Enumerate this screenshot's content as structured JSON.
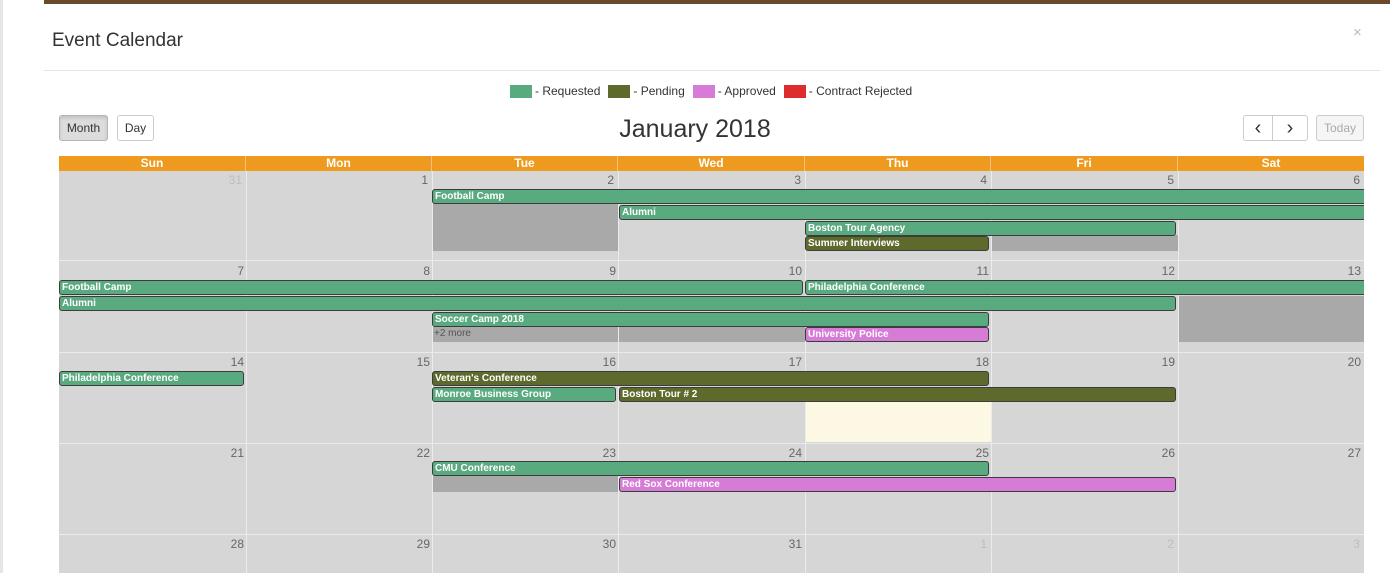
{
  "modal": {
    "title": "Event Calendar",
    "close_glyph": "×"
  },
  "legend": [
    {
      "label": "- Requested",
      "color": "#5aaa80"
    },
    {
      "label": "- Pending",
      "color": "#5d6a2c"
    },
    {
      "label": "- Approved",
      "color": "#d67bd6"
    },
    {
      "label": "- Contract Rejected",
      "color": "#dd2c2c"
    }
  ],
  "toolbar": {
    "month_label": "Month",
    "day_label": "Day",
    "title": "January 2018",
    "prev_glyph": "‹",
    "next_glyph": "›",
    "today_label": "Today"
  },
  "calendar": {
    "day_names": [
      "Sun",
      "Mon",
      "Tue",
      "Wed",
      "Thu",
      "Fri",
      "Sat"
    ],
    "weeks": [
      [
        "31",
        "1",
        "2",
        "3",
        "4",
        "5",
        "6"
      ],
      [
        "7",
        "8",
        "9",
        "10",
        "11",
        "12",
        "13"
      ],
      [
        "14",
        "15",
        "16",
        "17",
        "18",
        "19",
        "20"
      ],
      [
        "21",
        "22",
        "23",
        "24",
        "25",
        "26",
        "27"
      ],
      [
        "28",
        "29",
        "30",
        "31",
        "1",
        "2",
        "3"
      ]
    ],
    "events": [
      {
        "title": "Football Camp",
        "status": "requested"
      },
      {
        "title": "Alumni",
        "status": "requested"
      },
      {
        "title": "Boston Tour Agency",
        "status": "requested"
      },
      {
        "title": "Summer Interviews",
        "status": "pending"
      },
      {
        "title": "Football Camp",
        "status": "requested"
      },
      {
        "title": "Philadelphia Conference",
        "status": "requested"
      },
      {
        "title": "Alumni",
        "status": "requested"
      },
      {
        "title": "Soccer Camp 2018",
        "status": "requested"
      },
      {
        "title": "University Police",
        "status": "approved"
      },
      {
        "title": "Philadelphia Conference",
        "status": "requested"
      },
      {
        "title": "Veteran's Conference",
        "status": "pending"
      },
      {
        "title": "Monroe Business Group",
        "status": "requested"
      },
      {
        "title": "Boston Tour # 2",
        "status": "pending"
      },
      {
        "title": "CMU Conference",
        "status": "requested"
      },
      {
        "title": "Red Sox Conference",
        "status": "approved"
      }
    ],
    "more_label": "+2 more"
  }
}
